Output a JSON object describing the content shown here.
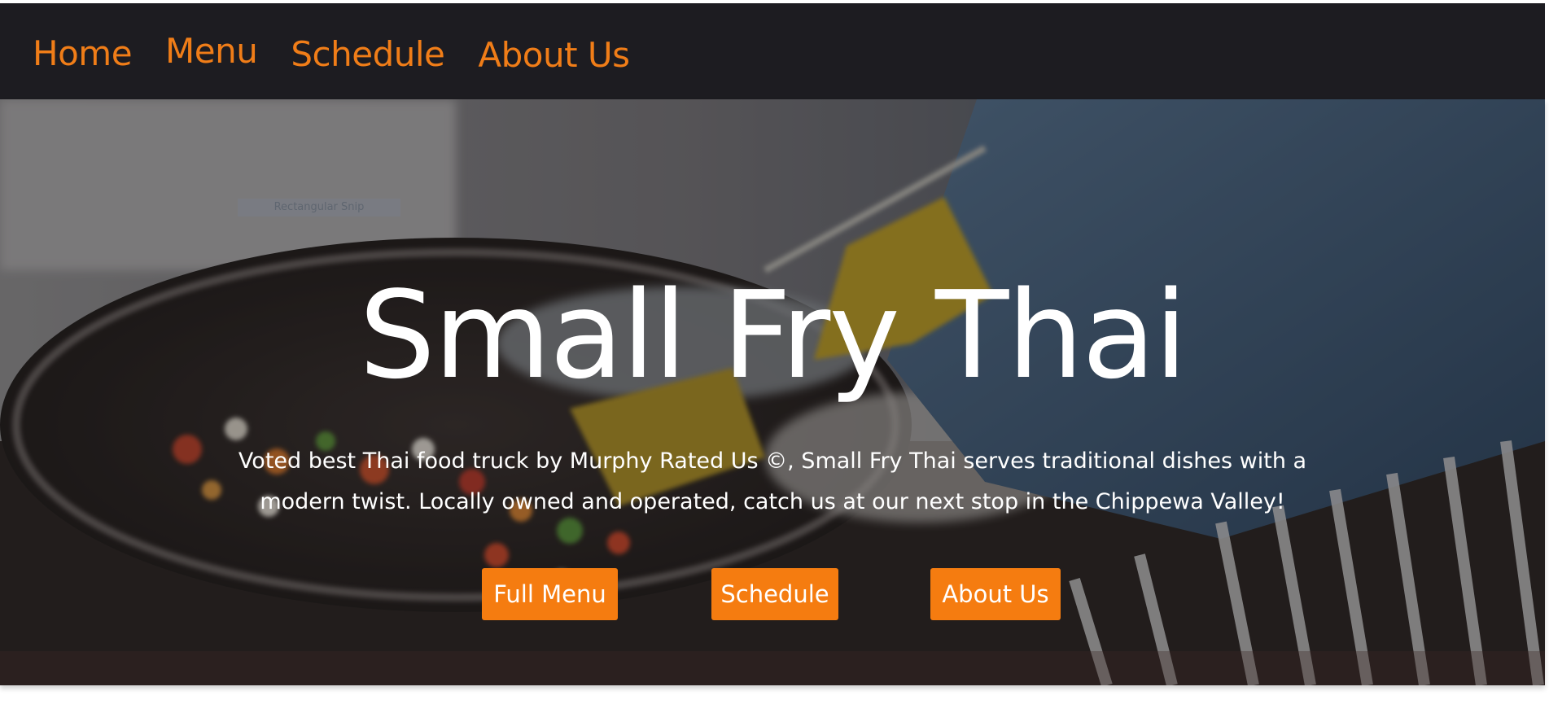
{
  "nav": {
    "items": [
      {
        "label": "Home"
      },
      {
        "label": "Menu"
      },
      {
        "label": "Schedule"
      },
      {
        "label": "About Us"
      }
    ]
  },
  "hero": {
    "title": "Small Fry Thai",
    "description": "Voted best Thai food truck by Murphy Rated Us ©, Small Fry Thai serves traditional dishes with a modern twist. Locally owned and operated, catch us at our next stop in the Chippewa Valley!",
    "buttons": [
      {
        "label": "Full Menu"
      },
      {
        "label": "Schedule"
      },
      {
        "label": "About Us"
      }
    ],
    "background_icon": "stir-fry-photo"
  },
  "overlay": {
    "snip_label": "Rectangular Snip"
  },
  "colors": {
    "nav_bg": "#1d1c21",
    "accent": "#f07d18",
    "button_bg": "#f57c10",
    "text_light": "#ffffff"
  }
}
